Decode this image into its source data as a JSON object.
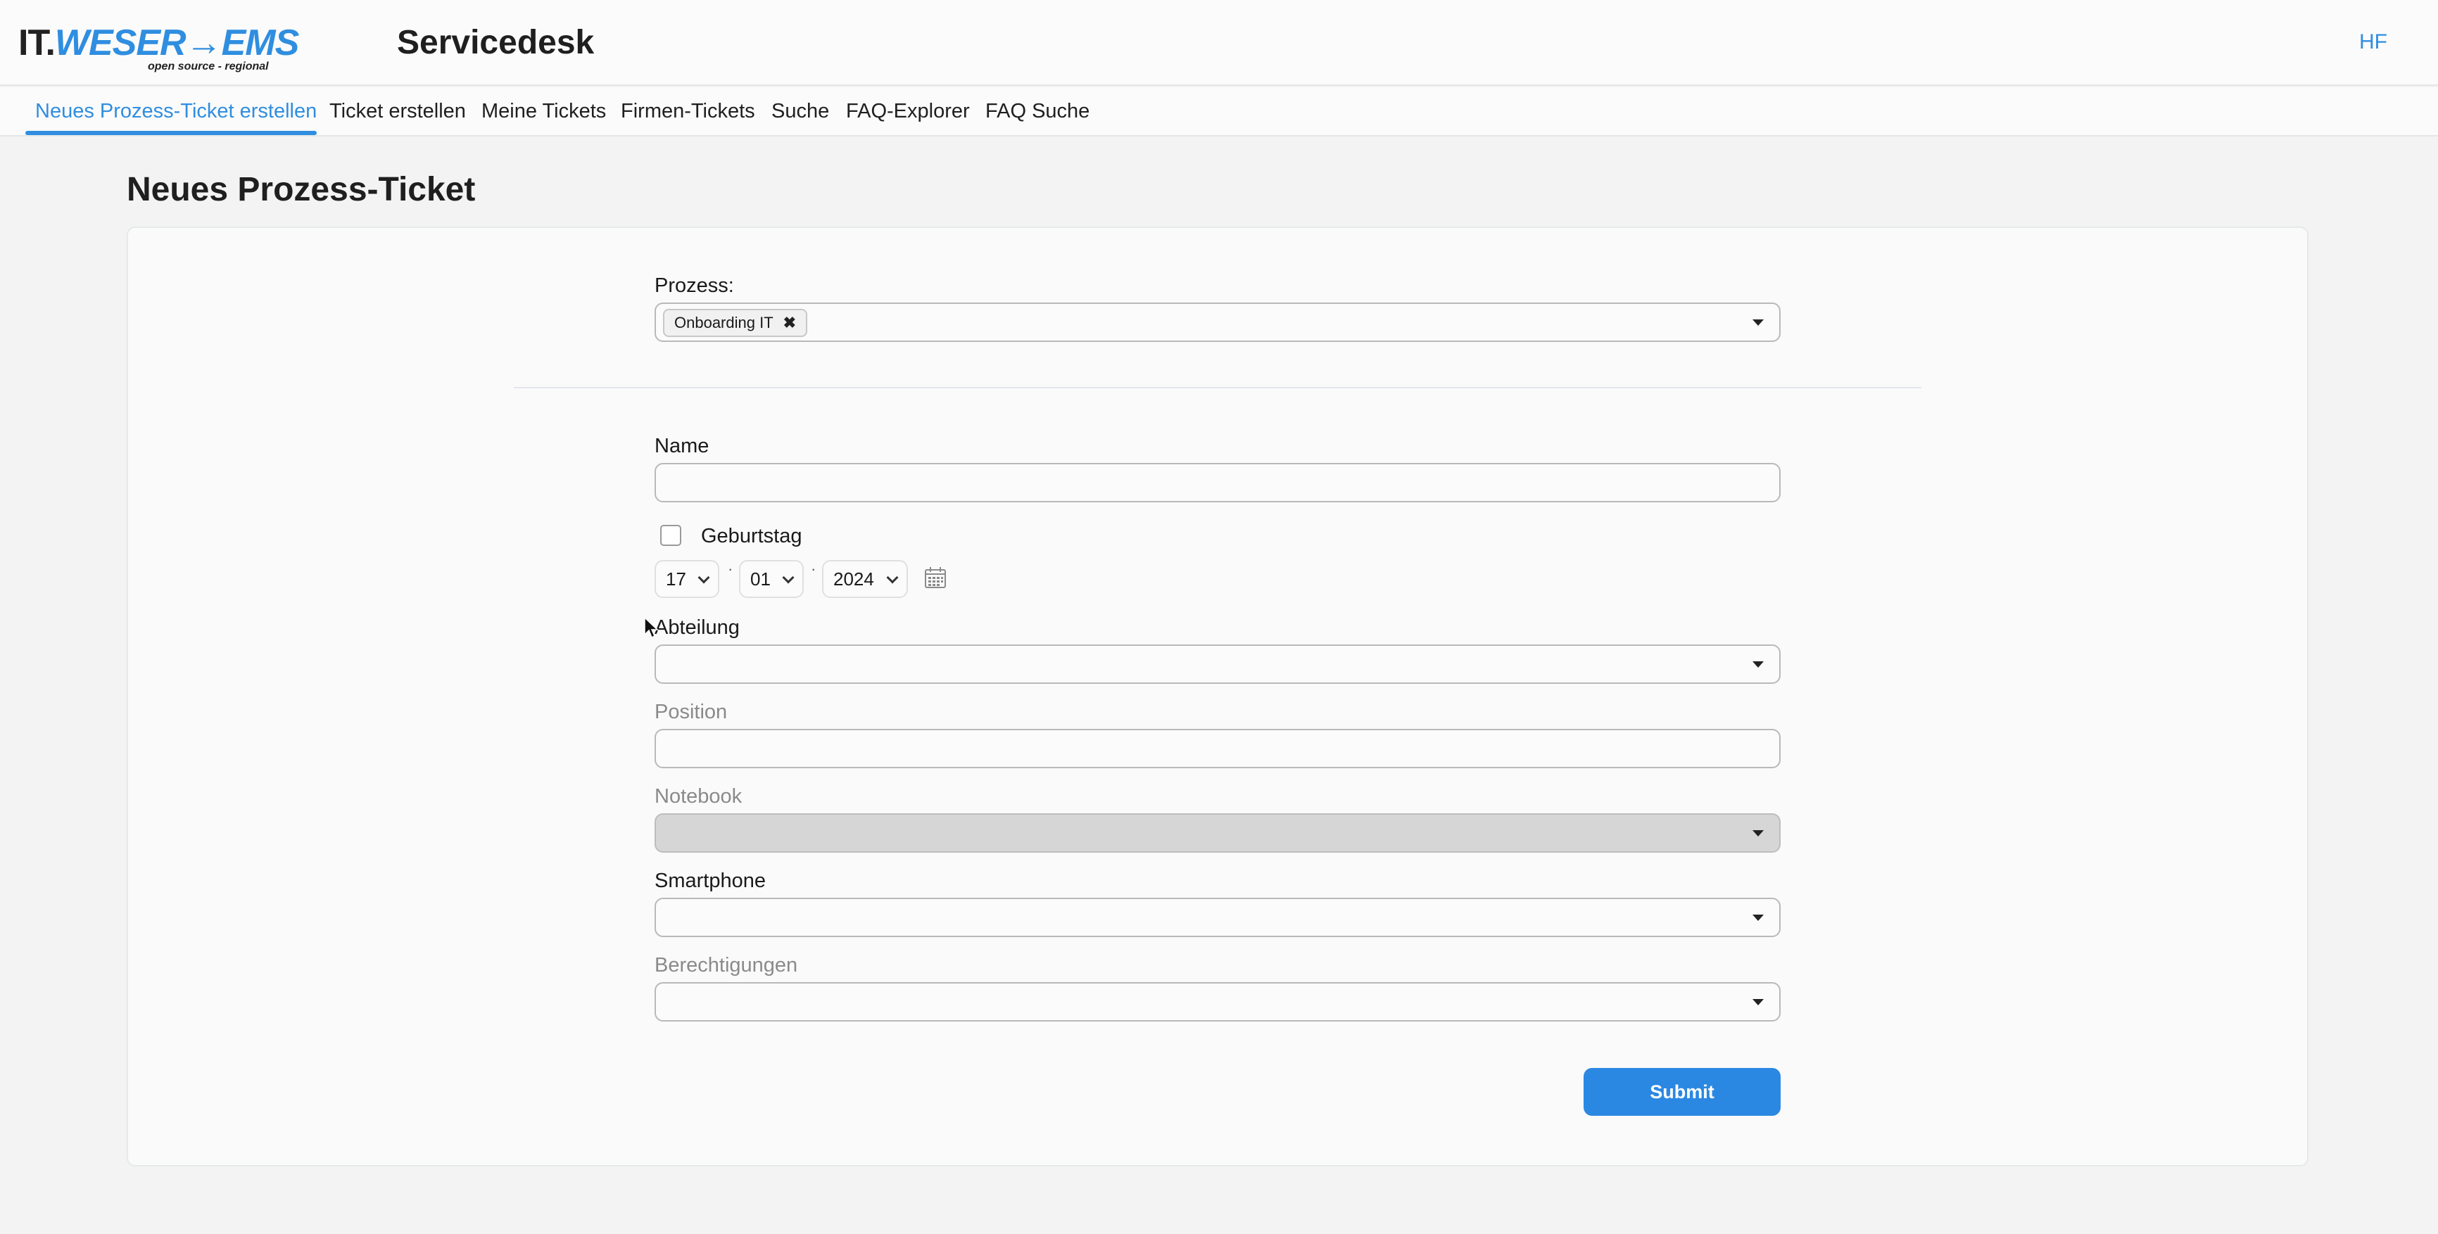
{
  "header": {
    "logo_prefix": "IT.",
    "logo_brand": "WESER→EMS",
    "logo_tagline": "open source - regional",
    "app_title": "Servicedesk",
    "user_initials": "HF"
  },
  "nav": {
    "items": [
      {
        "label": "Neues Prozess-Ticket erstellen",
        "active": true
      },
      {
        "label": "Ticket erstellen"
      },
      {
        "label": "Meine Tickets"
      },
      {
        "label": "Firmen-Tickets"
      },
      {
        "label": "Suche"
      },
      {
        "label": "FAQ-Explorer"
      },
      {
        "label": "FAQ Suche"
      }
    ]
  },
  "page": {
    "title": "Neues Prozess-Ticket"
  },
  "form": {
    "process": {
      "label": "Prozess:",
      "selected": "Onboarding IT"
    },
    "name": {
      "label": "Name",
      "value": ""
    },
    "birthday": {
      "label": "Geburtstag",
      "checked": false,
      "day": "17",
      "month": "01",
      "year": "2024"
    },
    "department": {
      "label": "Abteilung",
      "value": ""
    },
    "position": {
      "label": "Position",
      "value": ""
    },
    "notebook": {
      "label": "Notebook",
      "value": "",
      "disabled": true
    },
    "smartphone": {
      "label": "Smartphone",
      "value": ""
    },
    "permissions": {
      "label": "Berechtigungen",
      "value": ""
    },
    "submit_label": "Submit"
  },
  "colors": {
    "accent": "#2f8ee0",
    "button": "#2b88e2",
    "disabled_field": "#d6d6d6"
  }
}
